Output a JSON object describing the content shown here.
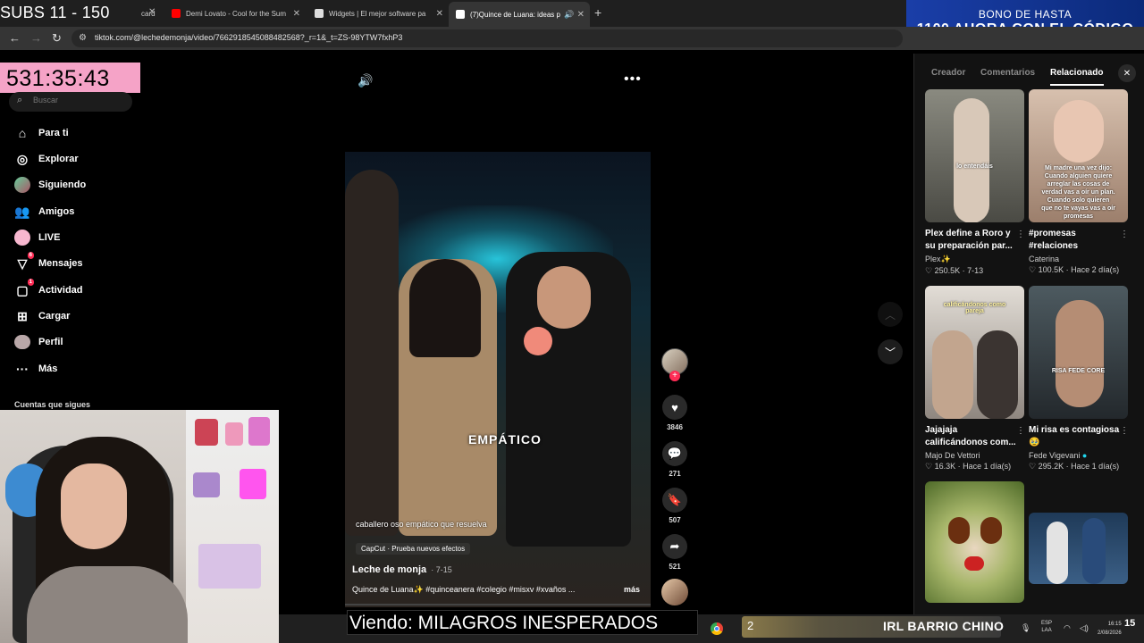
{
  "browser": {
    "tabs": [
      {
        "label": "card",
        "favicon_color": "#444444"
      },
      {
        "label": "Demi Lovato - Cool for the Sum",
        "favicon_color": "#ff0000"
      },
      {
        "label": "Widgets | El mejor software pa",
        "favicon_color": "#dddddd"
      },
      {
        "label": "(7)Quince de Luana: ideas p",
        "favicon_color": "#ffffff"
      }
    ],
    "new_tab": "+",
    "url": "tiktok.com/@lechedemonja/video/7662918545088482568?_r=1&_t=ZS-98YTW7fxhP3"
  },
  "overlay": {
    "subs": "SUBS 11 - 150",
    "timer": "531:35:43",
    "viewing": "Viendo: MILAGROS INESPERADOS"
  },
  "ad": {
    "line1": "BONO DE HASTA",
    "line2": "1100 AHORA CON EL CÓDIGO"
  },
  "sidebar": {
    "search_placeholder": "Buscar",
    "items": [
      {
        "label": "Para ti",
        "icon": "home-icon"
      },
      {
        "label": "Explorar",
        "icon": "compass-icon"
      },
      {
        "label": "Siguiendo",
        "icon": "following-avatar-icon"
      },
      {
        "label": "Amigos",
        "icon": "friends-icon"
      },
      {
        "label": "LIVE",
        "icon": "live-icon"
      },
      {
        "label": "Mensajes",
        "icon": "messages-icon",
        "badge": "6"
      },
      {
        "label": "Actividad",
        "icon": "activity-icon",
        "badge": "1"
      },
      {
        "label": "Cargar",
        "icon": "upload-icon"
      },
      {
        "label": "Perfil",
        "icon": "profile-icon"
      },
      {
        "label": "Más",
        "icon": "more-icon"
      }
    ],
    "following_title": "Cuentas que sigues"
  },
  "video": {
    "caption_overlay": "EMPÁTICO",
    "subtitle": "caballero oso empático que resuelva",
    "capcut": "CapCut · Prueba nuevos efectos",
    "author": "Leche de monja",
    "date": "· 7-15",
    "description": "Quince de Luana✨ #quinceanera #colegio #misxv #xvaños ...",
    "more": "más",
    "likes": "3846",
    "comments": "271",
    "saves": "507",
    "shares": "521"
  },
  "panel": {
    "tabs": [
      "Creador",
      "Comentarios",
      "Relacionado"
    ],
    "active_tab": "Relacionado",
    "cards": [
      {
        "title": "Plex define a Roro y su preparación par...",
        "author": "Plex✨",
        "views": "250.5K",
        "time": "· 7-13",
        "thumb_text": "lo entendáis",
        "bg": "#6b6a63"
      },
      {
        "title": "#promesas #relaciones",
        "author": "Caterina",
        "views": "100.5K",
        "time": "· Hace 2 día(s)",
        "thumb_text": "Mi madre una vez dijo: Cuando alguien quiere arreglar las cosas de verdad vas a oír un plan. Cuando solo quieren que no te vayas vas a oír promesas",
        "bg": "#b89a86"
      },
      {
        "title": "Jajajaja calificándonos com...",
        "author": "Majo De Vettori",
        "views": "16.3K",
        "time": "· Hace 1 día(s)",
        "thumb_text": "calificándonos como pareja",
        "bg": "#c9c3bd"
      },
      {
        "title": "Mi risa es contagiosa 🥹",
        "author": "Fede Vigevani",
        "views": "295.2K",
        "time": "· Hace 1 día(s)",
        "thumb_text": "RISA FEDE CORE",
        "bg": "#3c4a52"
      },
      {
        "title": "",
        "author": "",
        "views": "",
        "time": "",
        "thumb_text": "",
        "bg": "#6b8f3a"
      },
      {
        "title": "",
        "author": "",
        "views": "",
        "time": "",
        "thumb_text": "",
        "bg": "#2a3f5a"
      }
    ]
  },
  "taskbar": {
    "irl_num": "2",
    "irl_text": "IRL BARRIO CHINO",
    "lang_line1": "ESP",
    "lang_line2": "LAA",
    "time": "16:15",
    "date": "2/08/2026",
    "notifications": "15"
  }
}
